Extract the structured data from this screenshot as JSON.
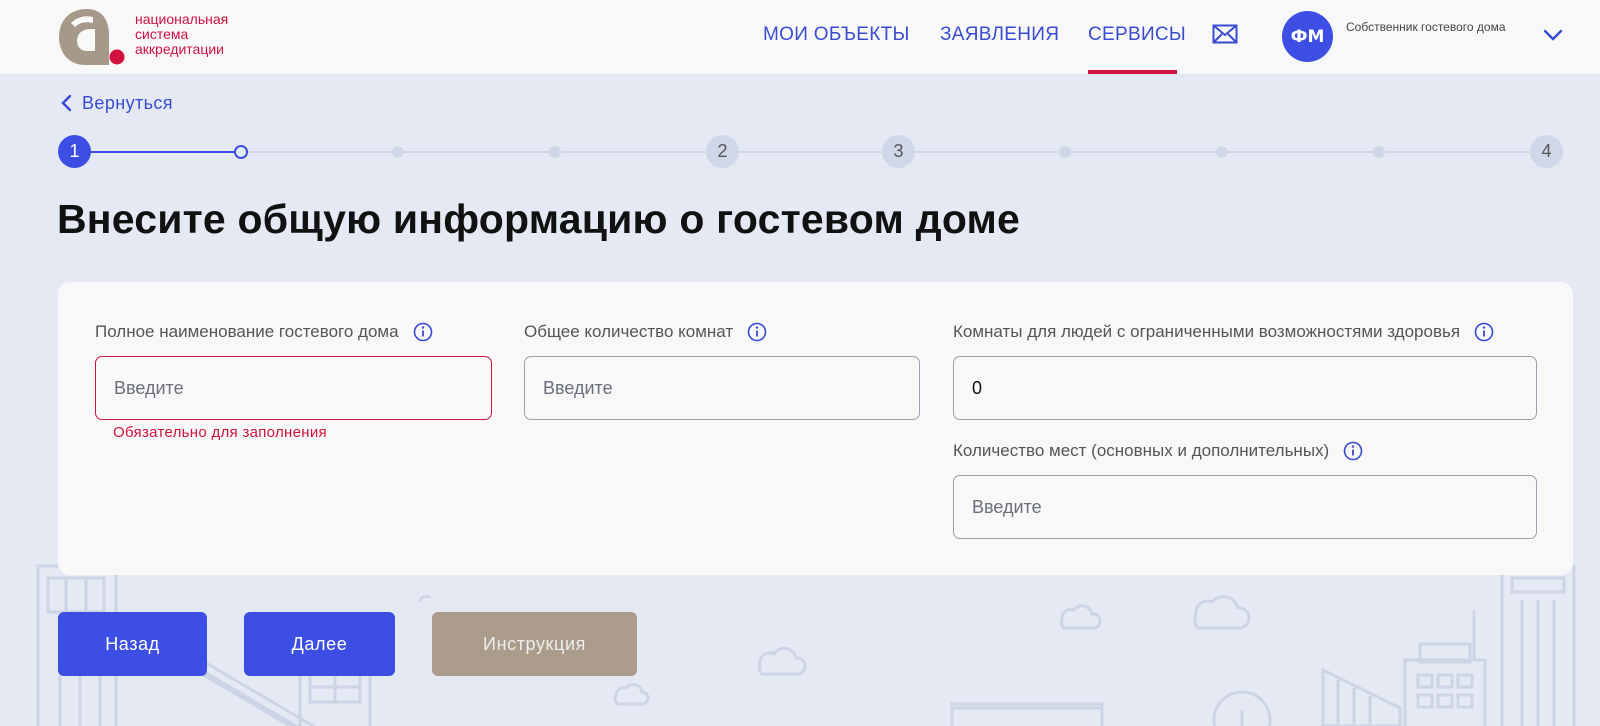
{
  "header": {
    "logo_text": "национальная\nсистема\nаккредитации",
    "nav": [
      {
        "label": "МОИ ОБЪЕКТЫ"
      },
      {
        "label": "ЗАЯВЛЕНИЯ"
      },
      {
        "label": "СЕРВИСЫ",
        "active": true
      }
    ],
    "avatar_initials": "ФМ",
    "user_role": "Собственник гостевого дома",
    "icons": {
      "mail": "mail-icon",
      "chevron": "chevron-down-icon"
    }
  },
  "back_link": {
    "label": "Вернуться",
    "icon": "chevron-left-icon"
  },
  "stepper": {
    "current_step": 1,
    "steps": [
      "1",
      "",
      "",
      "",
      "2",
      "3",
      "",
      "",
      "",
      "4"
    ]
  },
  "page_title": "Внесите общую информацию о гостевом доме",
  "form": {
    "full_name": {
      "label": "Полное наименование гостевого дома",
      "placeholder": "Введите",
      "value": "",
      "error": "Обязательно для заполнения"
    },
    "rooms_total": {
      "label": "Общее количество комнат",
      "placeholder": "Введите",
      "value": ""
    },
    "rooms_accessible": {
      "label": "Комнаты для людей с ограниченными возможностями здоровья",
      "placeholder": "Введите",
      "value": "0"
    },
    "places_count": {
      "label": "Количество мест (основных и дополнительных)",
      "placeholder": "Введите",
      "value": ""
    }
  },
  "buttons": {
    "back": "Назад",
    "next": "Далее",
    "instruction": "Инструкция"
  },
  "colors": {
    "accent": "#3d4ee4",
    "brand_red": "#d1123f",
    "secondary_button": "#aa9b8a",
    "page_background": "#e4e9f3"
  }
}
